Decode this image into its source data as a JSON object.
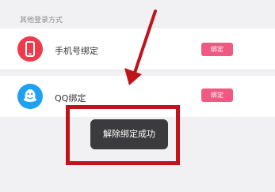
{
  "section": {
    "title": "其他登录方式"
  },
  "rows": [
    {
      "label": "手机号绑定",
      "button": "绑定",
      "icon": "phone-icon"
    },
    {
      "label": "QQ绑定",
      "button": "绑定",
      "icon": "qq-icon"
    }
  ],
  "toast": {
    "message": "解除绑定成功"
  },
  "colors": {
    "accent_button": "#f05a82",
    "phone_icon_bg": "#ee3b4b",
    "qq_icon_bg": "#1da1f2",
    "annotation_red": "#c0131a"
  }
}
